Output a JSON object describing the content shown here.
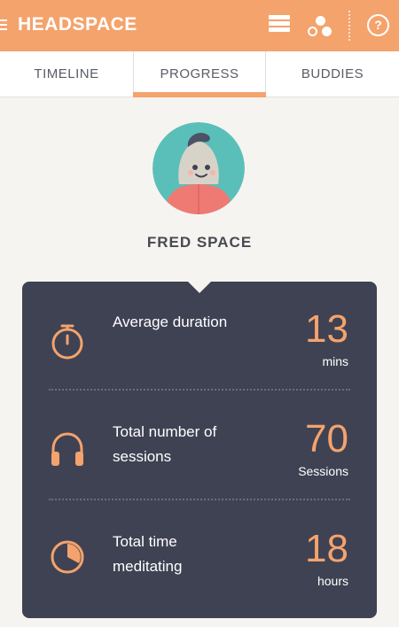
{
  "header": {
    "title": "HEADSPACE",
    "icons": [
      "menu-icon",
      "list-icon",
      "buddies-dots-icon",
      "help-icon"
    ],
    "help_label": "?"
  },
  "tabs": [
    {
      "label": "TIMELINE"
    },
    {
      "label": "PROGRESS",
      "selected": true
    },
    {
      "label": "BUDDIES"
    }
  ],
  "profile": {
    "name": "FRED SPACE"
  },
  "stats": [
    {
      "icon": "stopwatch-icon",
      "label": "Average duration",
      "value": "13",
      "unit": "mins"
    },
    {
      "icon": "headphones-icon",
      "label": "Total number of sessions",
      "value": "70",
      "unit": "Sessions"
    },
    {
      "icon": "pie-clock-icon",
      "label": "Total time meditating",
      "value": "18",
      "unit": "hours"
    }
  ],
  "colors": {
    "accent": "#f4a36c",
    "card": "#3f4253",
    "background": "#f6f4f0",
    "avatar_bg": "#5bbfb9"
  }
}
